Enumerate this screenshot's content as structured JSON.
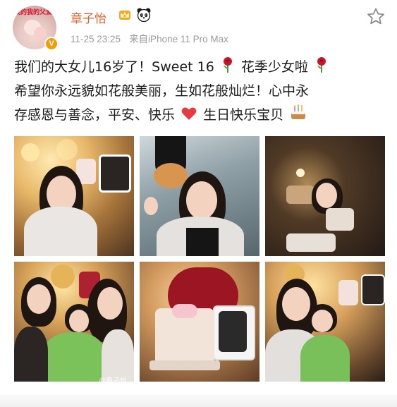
{
  "post": {
    "author": {
      "avatar_stamp_text": "我的我的父爱",
      "username": "章子怡",
      "verified_glyph": "V",
      "badges": [
        "crown-badge",
        "panda-badge"
      ]
    },
    "meta": {
      "time": "11-25 23:25",
      "source": "来自iPhone 11 Pro Max"
    },
    "text": {
      "line1_a": "我们的大女儿16岁了！Sweet 16",
      "line1_b": "花季少女啦",
      "line2": "希望你永远貌如花般美丽，生如花般灿烂！心中永",
      "line3_a": "存感恩与善念，平安、快乐",
      "line3_b": "生日快乐宝贝"
    },
    "images": {
      "count": 6,
      "watermark": "@章子怡"
    },
    "colors": {
      "username": "#e7602a",
      "meta": "#9b9b9b",
      "verified": "#f39b06",
      "text": "#1a1a1a"
    }
  }
}
